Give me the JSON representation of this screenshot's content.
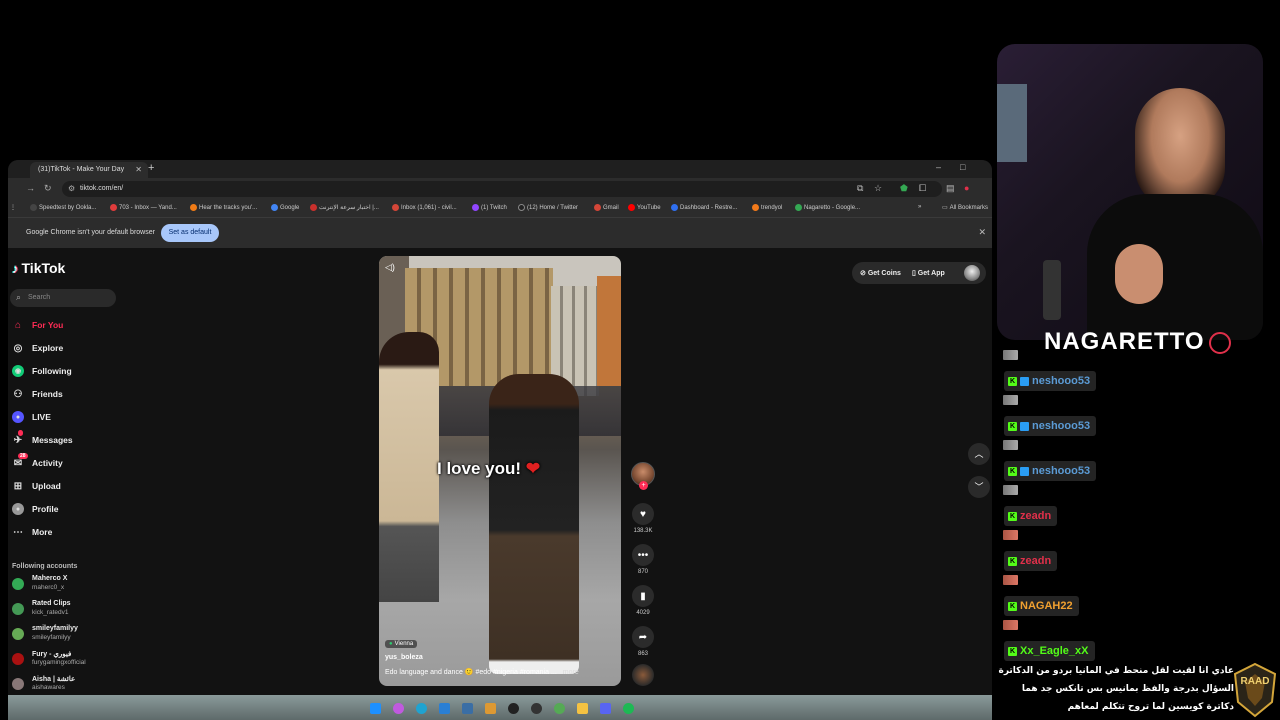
{
  "browser": {
    "tab_title": "(31)TikTok - Make Your Day",
    "url": "tiktok.com/en/",
    "bookmarks": [
      {
        "label": "Speedtest by Ookla...",
        "color": "#444"
      },
      {
        "label": "703 - Inbox — Yand...",
        "color": "#e03c3c"
      },
      {
        "label": "Hear the tracks you'...",
        "color": "#f07b16"
      },
      {
        "label": "Google",
        "color": "#4285f4"
      },
      {
        "label": "اختبار سرعة الإنترنت |...",
        "color": "#c9302c"
      },
      {
        "label": "Inbox (1,061) - civil...",
        "color": "#d44638"
      },
      {
        "label": "(1) Twitch",
        "color": "#9146ff"
      },
      {
        "label": "(12) Home / Twitter",
        "color": "#222"
      },
      {
        "label": "Gmail",
        "color": "#d44638"
      },
      {
        "label": "YouTube",
        "color": "#ff0000"
      },
      {
        "label": "Dashboard - Restre...",
        "color": "#2f6ff0"
      },
      {
        "label": "trendyol",
        "color": "#f27a1a"
      },
      {
        "label": "Nagaretto - Google...",
        "color": "#34a853"
      }
    ],
    "all_bookmarks": "All Bookmarks",
    "infobar_text": "Google Chrome isn't your default browser",
    "infobar_button": "Set as default"
  },
  "tiktok": {
    "logo": "TikTok",
    "search_placeholder": "Search",
    "nav": [
      {
        "label": "For You",
        "icon": "home-icon",
        "active": true
      },
      {
        "label": "Explore",
        "icon": "compass-icon"
      },
      {
        "label": "Following",
        "icon": "following-icon"
      },
      {
        "label": "Friends",
        "icon": "friends-icon"
      },
      {
        "label": "LIVE",
        "icon": "live-icon"
      },
      {
        "label": "Messages",
        "icon": "messages-icon"
      },
      {
        "label": "Activity",
        "icon": "activity-icon",
        "badge": "28"
      },
      {
        "label": "Upload",
        "icon": "upload-icon"
      },
      {
        "label": "Profile",
        "icon": "profile-icon"
      },
      {
        "label": "More",
        "icon": "more-icon"
      }
    ],
    "following_header": "Following accounts",
    "accounts": [
      {
        "name": "Maherco X",
        "handle": "maherc0_x",
        "color": "#3a5"
      },
      {
        "name": "Rated Clips",
        "handle": "kick_ratedv1",
        "color": "#495"
      },
      {
        "name": "smileyfamilyy",
        "handle": "smileyfamilyy",
        "color": "#6a5"
      },
      {
        "name": "Fury - فيوري",
        "handle": "furygamingxofficial",
        "color": "#a11"
      },
      {
        "name": "Aisha | عائشة",
        "handle": "aishawares",
        "color": "#877"
      }
    ],
    "get_coins": "Get Coins",
    "get_app": "Get App",
    "video": {
      "caption": "I love you!",
      "heart": "❤",
      "location": "Vienna",
      "user": "yus_boleza",
      "description": "Edo language and dance 🙂 #edo #nigeria #romania ...",
      "more": "more"
    },
    "actions": {
      "likes": "138.3K",
      "comments": "870",
      "saves": "4029",
      "shares": "863"
    }
  },
  "stream": {
    "brand": "NAGARETTO",
    "chat": [
      {
        "name": "neshooo53",
        "color": "#5b9bd5",
        "subscriber": true
      },
      {
        "name": "neshooo53",
        "color": "#5b9bd5",
        "subscriber": true
      },
      {
        "name": "neshooo53",
        "color": "#5b9bd5",
        "subscriber": true
      },
      {
        "name": "zeadn",
        "color": "#e0304a",
        "subscriber": false
      },
      {
        "name": "zeadn",
        "color": "#e0304a",
        "subscriber": false
      },
      {
        "name": "NAGAH22",
        "color": "#f0a030",
        "subscriber": false
      },
      {
        "name": "Xx_Eagle_xX",
        "color": "#53fc18",
        "subscriber": false
      }
    ],
    "message": "عادي انا لقيت لقل منحط في المانيا بردو من الدكاترة السؤال بدرجة والفظ بمانيس بس تانكس جد هما دكاترة كويسين لما تروح تتكلم لمعاهم",
    "overlay_logo": "RAAD"
  }
}
